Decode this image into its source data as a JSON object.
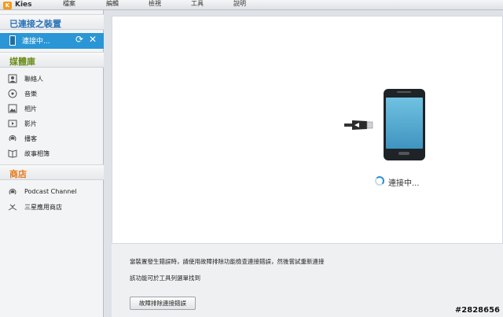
{
  "app": {
    "name": "Kies",
    "logo_letter": "K"
  },
  "menu": [
    "檔案",
    "編輯",
    "檢視",
    "工具",
    "說明"
  ],
  "sidebar": {
    "connected_header": "已連接之裝置",
    "device": {
      "label": "連接中..."
    },
    "library_header": "媒體庫",
    "library_items": [
      {
        "label": "聯絡人",
        "icon": "contacts-icon"
      },
      {
        "label": "音樂",
        "icon": "music-icon"
      },
      {
        "label": "相片",
        "icon": "photos-icon"
      },
      {
        "label": "影片",
        "icon": "videos-icon"
      },
      {
        "label": "播客",
        "icon": "podcast-icon"
      },
      {
        "label": "故事相簿",
        "icon": "story-album-icon"
      }
    ],
    "store_header": "商店",
    "store_items": [
      {
        "label": "Podcast Channel",
        "icon": "podcast-channel-icon"
      },
      {
        "label": "三星應用商店",
        "icon": "samsung-apps-icon"
      }
    ]
  },
  "main": {
    "status": "連接中...",
    "help_line1": "當裝置發生錯誤時，請使用故障排除功能檢查連接錯誤，然後嘗試重新連接",
    "help_line2": "該功能可於工具列選單找到",
    "troubleshoot_button": "故障排除連接錯誤"
  },
  "watermark": "#2828656",
  "colors": {
    "accent_blue": "#2a96d6",
    "library_green": "#6c8f1d",
    "store_orange": "#e4791a"
  }
}
